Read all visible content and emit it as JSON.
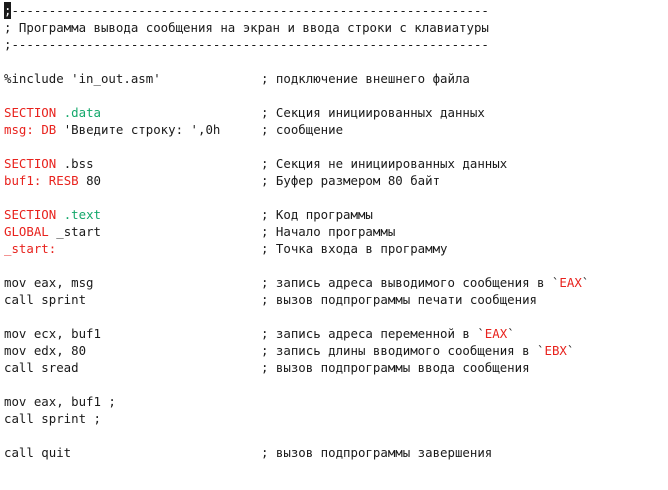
{
  "header": {
    "rule_top_cursor": ";",
    "rule_top_rest": "----------------------------------------------------------------",
    "title": "; Программа вывода сообщения на экран и ввода строки с клавиатуры",
    "rule_bottom": ";----------------------------------------------------------------"
  },
  "include": {
    "code": "%include 'in_out.asm'",
    "comment": "; подключение внешнего файла"
  },
  "data_section": {
    "section_kw": "SECTION",
    "section_name": ".data",
    "section_comment": "; Секция инициированных данных",
    "msg_label": "msg:",
    "msg_dir": "DB",
    "msg_value": "'Введите строку: ',0h",
    "msg_comment": "; сообщение"
  },
  "bss_section": {
    "section_kw": "SECTION",
    "section_name": ".bss",
    "section_comment": "; Секция не инициированных данных",
    "buf_label": "buf1:",
    "buf_dir": "RESB",
    "buf_value": "80",
    "buf_comment": "; Буфер размером 80 байт"
  },
  "text_section": {
    "section_kw": "SECTION",
    "section_name": ".text",
    "section_comment": "; Код программы",
    "global_kw": "GLOBAL",
    "global_name": "_start",
    "global_comment": "; Начало программы",
    "start_label": "_start:",
    "start_comment": "; Точка входа в программу"
  },
  "block1": {
    "line1_code": "mov eax, msg",
    "line1_comment_pre": "; запись адреса выводимого сообщения в `",
    "line1_comment_reg": "EAX",
    "line1_comment_post": "`",
    "line2_code": "call sprint",
    "line2_comment": "; вызов подпрограммы печати сообщения"
  },
  "block2": {
    "line1_code": "mov ecx, buf1",
    "line1_comment_pre": "; запись адреса переменной в `",
    "line1_comment_reg": "EAX",
    "line1_comment_post": "`",
    "line2_code": "mov edx, 80",
    "line2_comment_pre": "; запись длины вводимого сообщения в `",
    "line2_comment_reg": "EBX",
    "line2_comment_post": "`",
    "line3_code": "call sread",
    "line3_comment": "; вызов подпрограммы ввода сообщения"
  },
  "block3": {
    "line1_code": "mov eax, buf1 ;",
    "line2_code": "call sprint ;"
  },
  "block4": {
    "line1_code": "call quit",
    "line1_comment": "; вызов подпрограммы завершения"
  },
  "colors": {
    "keyword": "#e8221d",
    "section_name": "#14a86b",
    "text": "#1a1a1a",
    "background": "#ffffff"
  }
}
